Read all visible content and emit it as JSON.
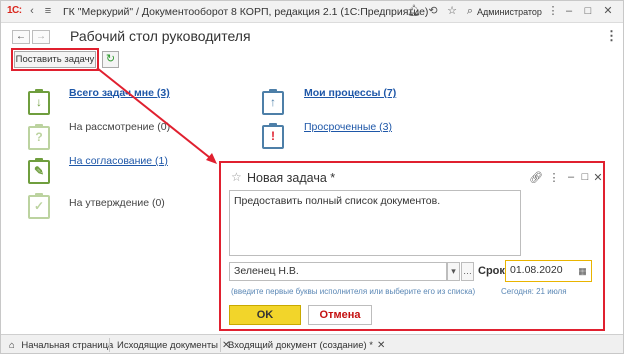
{
  "app": {
    "logo": "1С:",
    "title": "ГК \"Меркурий\" / Документооборот 8 КОРП, редакция 2.1  (1С:Предприятие)",
    "user": "Администратор"
  },
  "page": {
    "title": "Рабочий стол руководителя",
    "create_task_label": "Поставить задачу"
  },
  "items": {
    "all_tasks": "Всего задач мне (3)",
    "review": "На рассмотрение (0)",
    "approval": "На согласование (1)",
    "confirm": "На утверждение (0)",
    "my_processes": "Мои процессы (7)",
    "overdue": "Просроченные (3)"
  },
  "dialog": {
    "title": "Новая задача *",
    "description": "Предоставить полный список документов.",
    "assignee": "Зеленец Н.В.",
    "assignee_hint": "(введите первые буквы исполнителя или выберите его из списка)",
    "deadline_label": "Срок:",
    "deadline": "01.08.2020",
    "today_hint": "Сегодня: 21 июля",
    "ok_label": "OK",
    "cancel_label": "Отмена"
  },
  "tabs": [
    {
      "label": "Начальная страница"
    },
    {
      "label": "Исходящие документы"
    },
    {
      "label": "Входящий документ (создание) *"
    }
  ],
  "colors": {
    "highlight": "#e0202f",
    "link": "#1e57a8",
    "ok_button": "#f2d52a",
    "icon_green": "#6f9e3e"
  }
}
